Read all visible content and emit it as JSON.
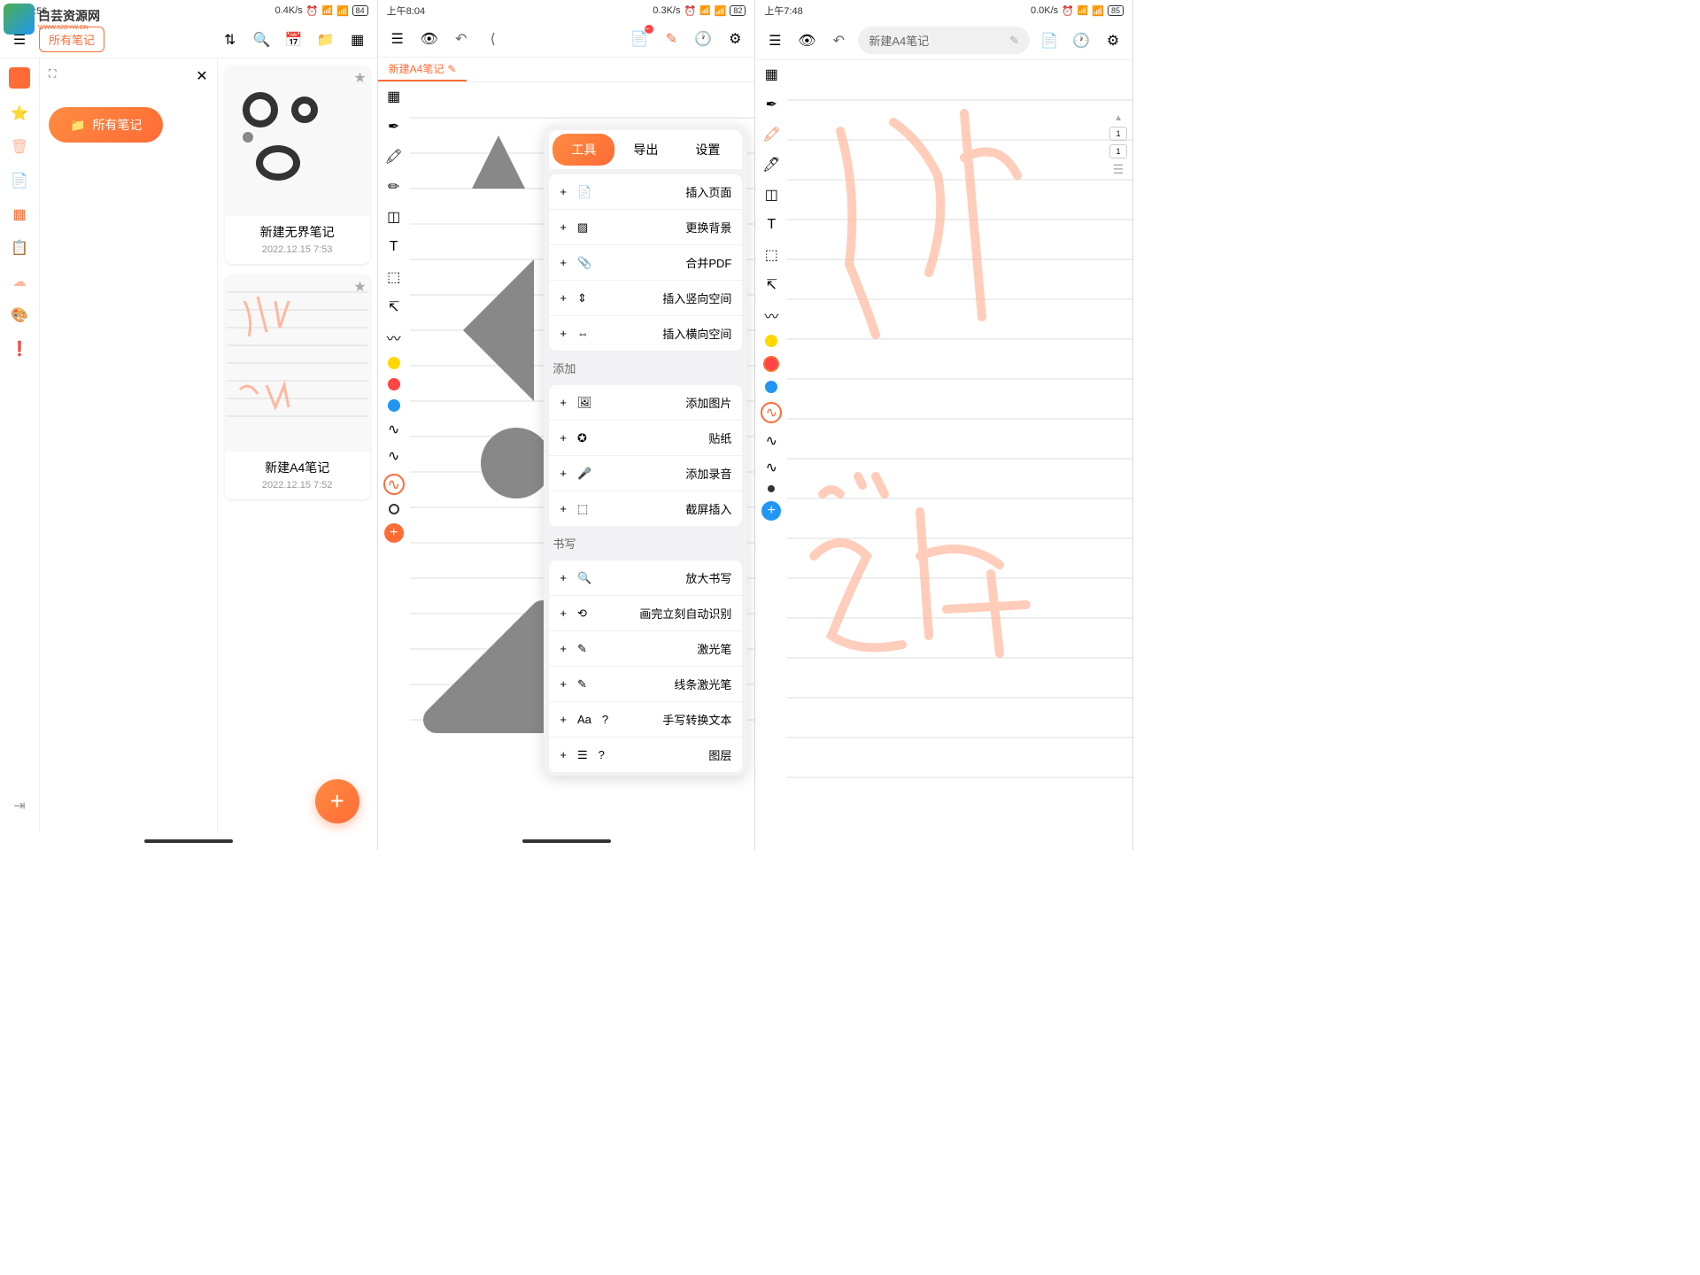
{
  "watermark": {
    "main": "白芸资源网",
    "sub": "WWW.52BYW.CN"
  },
  "screen1": {
    "status": {
      "time": "上午7:56",
      "speed": "0.4K/s",
      "battery": "84"
    },
    "all_notes_tag": "所有笔记",
    "folder_btn": "所有笔记",
    "note1": {
      "title": "新建无界笔记",
      "date": "2022.12.15 7:53"
    },
    "note2": {
      "title": "新建A4笔记",
      "date": "2022.12.15 7:52"
    }
  },
  "screen2": {
    "status": {
      "time": "上午8:04",
      "speed": "0.3K/s",
      "battery": "82"
    },
    "tab_title": "新建A4笔记",
    "popup": {
      "tabs": {
        "tools": "工具",
        "export": "导出",
        "settings": "设置"
      },
      "items": {
        "insert_page": "插入页面",
        "change_bg": "更换背景",
        "merge_pdf": "合并PDF",
        "insert_v": "插入竖向空间",
        "insert_h": "插入横向空间",
        "add_header": "添加",
        "add_image": "添加图片",
        "sticker": "贴纸",
        "add_audio": "添加录音",
        "screenshot": "截屏插入",
        "write_header": "书写",
        "zoom_write": "放大书写",
        "auto_recog": "画完立刻自动识别",
        "laser": "激光笔",
        "line_laser": "线条激光笔",
        "hand_to_text": "手写转换文本",
        "layers": "图层"
      }
    }
  },
  "screen3": {
    "status": {
      "time": "上午7:48",
      "speed": "0.0K/s",
      "battery": "85"
    },
    "title": "新建A4笔记",
    "page_indicator": {
      "current": "1",
      "total": "1"
    }
  }
}
